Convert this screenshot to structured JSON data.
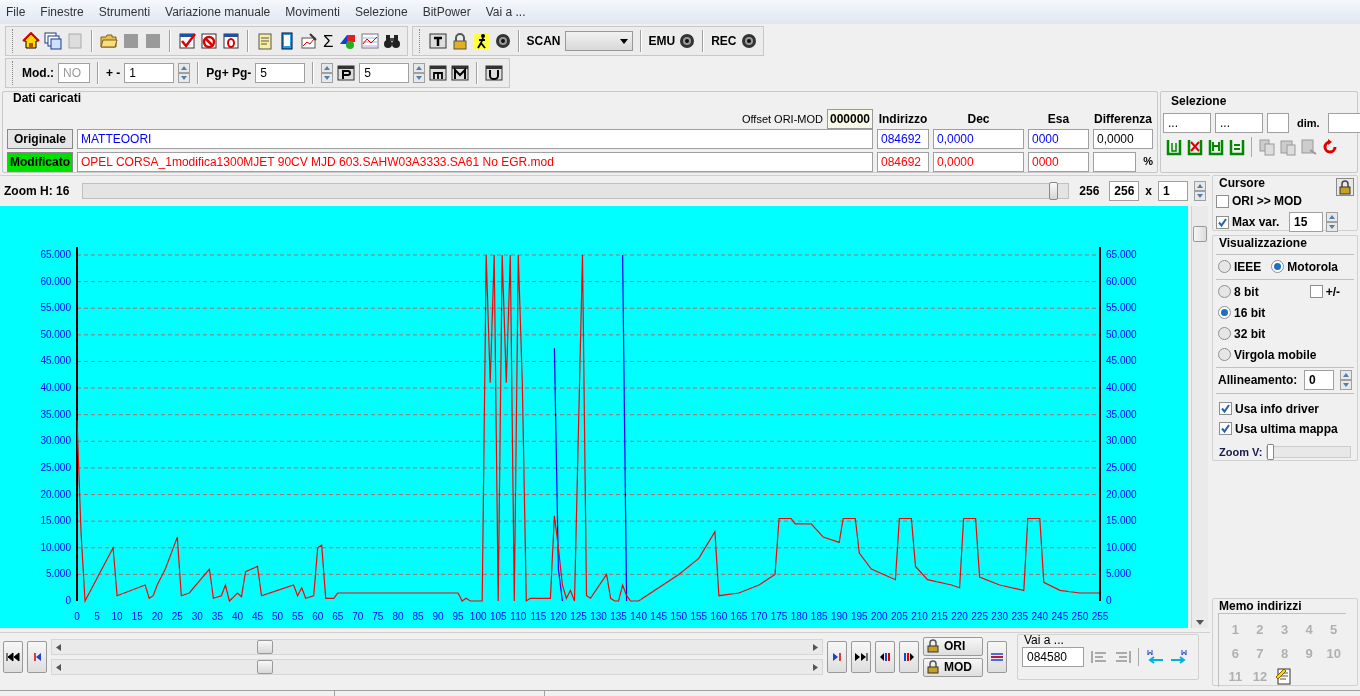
{
  "menu": [
    "File",
    "Finestre",
    "Strumenti",
    "Variazione manuale",
    "Movimenti",
    "Selezione",
    "BitPower",
    "Vai a ..."
  ],
  "toolbar": {
    "sigma": "Σ",
    "scan_label": "SCAN",
    "emu_label": "EMU",
    "rec_label": "REC"
  },
  "toolbar2": {
    "mod_label": "Mod.:",
    "mod_value": "NO",
    "step_label": "+ -",
    "step_value": "1",
    "page_label": "Pg+ Pg-",
    "page_value": "5",
    "p_value": "5"
  },
  "dati": {
    "title": "Dati caricati",
    "offset_label": "Offset ORI-MOD",
    "offset_value": "000000",
    "columns": [
      "Indirizzo",
      "Dec",
      "Esa",
      "Differenza"
    ],
    "rows": [
      {
        "label": "Originale",
        "selected": false,
        "color": "#0000ff",
        "file": "MATTEOORI",
        "address": "084692",
        "dec": "0,0000",
        "hex": "0000",
        "diff": "0,0000"
      },
      {
        "label": "Modificato",
        "selected": true,
        "color": "#ff0000",
        "file": "OPEL CORSA_1modifica1300MJET 90CV MJD 603.SAHW03A3333.SA61 No EGR.mod",
        "address": "084692",
        "dec": "0,0000",
        "hex": "0000",
        "unit": "%"
      }
    ]
  },
  "selezione": {
    "title": "Selezione",
    "fields": [
      "...",
      "..."
    ],
    "dim_label": "dim."
  },
  "zoom": {
    "label": "Zoom H: 16",
    "level": 0.99,
    "reading": "256",
    "value": "256",
    "times": "x",
    "factor": "1"
  },
  "cursore": {
    "title": "Cursore",
    "ori_mod": {
      "label": "ORI >> MOD",
      "checked": false
    },
    "max_var": {
      "label": "Max var.",
      "checked": true,
      "value": "15"
    }
  },
  "visualizzazione": {
    "title": "Visualizzazione",
    "byte_order": [
      {
        "label": "IEEE",
        "selected": false
      },
      {
        "label": "Motorola",
        "selected": true
      }
    ],
    "sizes": [
      {
        "label": "8 bit",
        "selected": false
      },
      {
        "label": "16 bit",
        "selected": true
      },
      {
        "label": "32 bit",
        "selected": false
      },
      {
        "label": "Virgola mobile",
        "selected": false
      }
    ],
    "signed": {
      "label": "+/-",
      "checked": false
    },
    "align_label": "Allineamento:",
    "align_value": "0",
    "options": [
      {
        "label": "Usa info driver",
        "checked": true
      },
      {
        "label": "Usa ultima mappa",
        "checked": true
      }
    ],
    "zoom_v": {
      "label": "Zoom V:",
      "level": 0
    }
  },
  "memo": {
    "title": "Memo indirizzi",
    "items": [
      {
        "label": "1",
        "disabled": true
      },
      {
        "label": "2",
        "disabled": true
      },
      {
        "label": "3",
        "disabled": true
      },
      {
        "label": "4",
        "disabled": true
      },
      {
        "label": "5",
        "disabled": true
      },
      {
        "label": "6",
        "disabled": true
      },
      {
        "label": "7",
        "disabled": true
      },
      {
        "label": "8",
        "disabled": true
      },
      {
        "label": "9",
        "disabled": true
      },
      {
        "label": "10",
        "disabled": true
      },
      {
        "label": "11",
        "disabled": true
      },
      {
        "label": "12",
        "disabled": true
      }
    ]
  },
  "bottom": {
    "ori_label": "ORI",
    "mod_label": "MOD",
    "goto_title": "Vai a ...",
    "goto_value": "084580"
  },
  "chart": {
    "chart_data": {
      "type": "line",
      "grid": true,
      "x": [
        0,
        1,
        2,
        9,
        10,
        17,
        18,
        19,
        20,
        22,
        25,
        26,
        28,
        33,
        34,
        36,
        37,
        38,
        40,
        41,
        42,
        45,
        46,
        50,
        54,
        55,
        56,
        57,
        59,
        60,
        61,
        62,
        64,
        65,
        95,
        96,
        97,
        98,
        101,
        102,
        103,
        104,
        105,
        106,
        107,
        108,
        109,
        110,
        111,
        112,
        113,
        118,
        119,
        120,
        121,
        122,
        123,
        124,
        126,
        127,
        128,
        132,
        133,
        134,
        135,
        136,
        137,
        138,
        140,
        141,
        150,
        155,
        159,
        160,
        165,
        170,
        174,
        175,
        178,
        179,
        183,
        186,
        190,
        191,
        194,
        195,
        198,
        204,
        205,
        208,
        209,
        212,
        218,
        220,
        221,
        224,
        225,
        230,
        236,
        237,
        240,
        241,
        245,
        250,
        255
      ],
      "series": [
        {
          "color": "#0000ff",
          "values": [
            null,
            null,
            null,
            null,
            null,
            null,
            null,
            null,
            null,
            null,
            null,
            null,
            null,
            null,
            null,
            null,
            null,
            null,
            null,
            null,
            null,
            null,
            null,
            null,
            null,
            null,
            null,
            null,
            null,
            null,
            null,
            null,
            null,
            null,
            null,
            null,
            null,
            null,
            null,
            null,
            null,
            null,
            null,
            null,
            null,
            null,
            null,
            null,
            null,
            null,
            null,
            null,
            47500,
            6000,
            0,
            null,
            null,
            null,
            null,
            null,
            null,
            null,
            null,
            null,
            null,
            65000,
            0,
            null,
            null,
            null,
            null,
            null,
            null,
            null,
            null,
            null,
            null,
            null,
            null,
            null,
            null,
            null,
            null,
            null,
            null,
            null,
            null,
            null,
            null,
            null,
            null,
            null,
            null,
            null,
            null,
            null,
            null,
            null,
            null,
            null,
            null,
            null,
            null,
            null,
            null
          ]
        },
        {
          "color": "#ff0000",
          "values": [
            34000,
            13000,
            0,
            10000,
            1000,
            3000,
            500,
            1000,
            3000,
            6000,
            12000,
            1000,
            1500,
            6000,
            500,
            1000,
            3000,
            0,
            1500,
            800,
            5500,
            6500,
            1000,
            2000,
            3000,
            1000,
            2500,
            500,
            1000,
            10000,
            10500,
            500,
            500,
            1500,
            1500,
            0,
            500,
            0,
            0,
            65000,
            41000,
            65000,
            0,
            65000,
            41000,
            65000,
            0,
            65000,
            41000,
            0,
            500,
            500,
            16000,
            10000,
            3000,
            500,
            2000,
            0,
            65000,
            1000,
            500,
            5000,
            500,
            0,
            0,
            3000,
            1000,
            0,
            0,
            500,
            5000,
            8000,
            13000,
            1000,
            1500,
            3000,
            5000,
            15500,
            15500,
            14500,
            14500,
            12000,
            11000,
            15500,
            15500,
            9000,
            6000,
            4000,
            15500,
            15500,
            6500,
            4000,
            3000,
            2500,
            15500,
            15500,
            4500,
            3000,
            2000,
            15500,
            15500,
            3500,
            2000,
            1500,
            1500
          ]
        }
      ],
      "ylim": [
        0,
        65000
      ],
      "xlim": [
        0,
        255
      ],
      "yticks": [
        {
          "value": 0,
          "label": "0"
        },
        {
          "value": 5000,
          "label": "5.000"
        },
        {
          "value": 10000,
          "label": "10.000"
        },
        {
          "value": 15000,
          "label": "15.000"
        },
        {
          "value": 20000,
          "label": "20.000"
        },
        {
          "value": 25000,
          "label": "25.000"
        },
        {
          "value": 30000,
          "label": "30.000"
        },
        {
          "value": 35000,
          "label": "35.000"
        },
        {
          "value": 40000,
          "label": "40.000"
        },
        {
          "value": 45000,
          "label": "45.000"
        },
        {
          "value": 50000,
          "label": "50.000"
        },
        {
          "value": 55000,
          "label": "55.000"
        },
        {
          "value": 60000,
          "label": "60.000"
        },
        {
          "value": 65000,
          "label": "65.000"
        }
      ],
      "xticks": [
        0,
        5,
        10,
        15,
        20,
        25,
        30,
        35,
        40,
        45,
        50,
        55,
        60,
        65,
        70,
        75,
        80,
        85,
        90,
        95,
        100,
        105,
        110,
        115,
        120,
        125,
        130,
        135,
        140,
        145,
        150,
        155,
        160,
        165,
        170,
        175,
        180,
        185,
        190,
        195,
        200,
        205,
        210,
        215,
        220,
        225,
        230,
        235,
        240,
        245,
        250,
        255
      ]
    }
  }
}
